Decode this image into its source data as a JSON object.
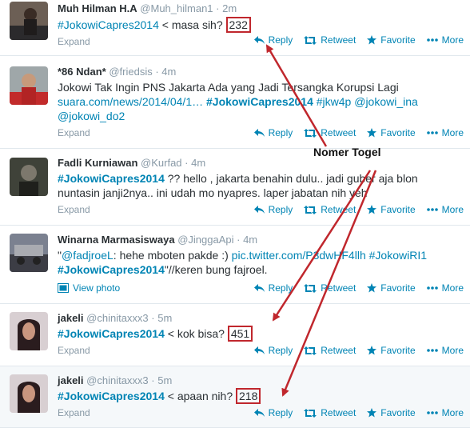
{
  "tweets": [
    {
      "fullname": "Muh Hilman H.A",
      "username": "@Muh_hilman1",
      "time": "2m",
      "text_parts": [
        "#JokowiCapres2014",
        " < masa sih? ",
        "232"
      ],
      "footer": "Expand"
    },
    {
      "fullname": "*86 Ndan*",
      "username": "@friedsis",
      "time": "4m",
      "line1": "Jokowi Tak Ingin PNS Jakarta Ada yang Jadi Tersangka Korupsi Lagi",
      "link": "suara.com/news/2014/04/1…",
      "hashtag": "#JokowiCapres2014",
      "tag2": "#jkw4p",
      "mention1": "@jokowi_ina",
      "mention2": "@jokowi_do2",
      "footer": "Expand"
    },
    {
      "fullname": "Fadli Kurniawan",
      "username": "@Kurfad",
      "time": "4m",
      "hashtag": "#JokowiCapres2014",
      "text": " ?? hello , jakarta benahin dulu.. jadi guber aja blon",
      "line2": "nuntasin janji2nya.. ini udah mo nyapres. laper jabatan nih yeh",
      "footer": "Expand"
    },
    {
      "fullname": "Winarna Marmasiswaya",
      "username": "@JinggaApi",
      "time": "4m",
      "quote_open": "\"",
      "mention": "@fadjroeL",
      "text": ": hehe mboten pakde :) ",
      "link": "pic.twitter.com/P3dwHF4llh",
      "tag2": "#JokowiRI1",
      "hashtag": "#JokowiCapres2014",
      "tail": "\"//keren bung fajroel.",
      "footer": "View photo"
    },
    {
      "fullname": "jakeli",
      "username": "@chinitaxxx3",
      "time": "5m",
      "text_parts": [
        "#JokowiCapres2014",
        " < kok bisa? ",
        "451"
      ],
      "footer": "Expand"
    },
    {
      "fullname": "jakeli",
      "username": "@chinitaxxx3",
      "time": "5m",
      "text_parts": [
        "#JokowiCapres2014",
        " < apaan nih? ",
        "218"
      ],
      "footer": "Expand"
    }
  ],
  "actions": {
    "reply": "Reply",
    "retweet": "Retweet",
    "favorite": "Favorite",
    "more": "More"
  },
  "separator": "·",
  "annotation": {
    "label": "Nomer Togel"
  },
  "colors": {
    "link": "#0084b4",
    "annotation": "#c0272d",
    "muted": "#8899a6"
  }
}
